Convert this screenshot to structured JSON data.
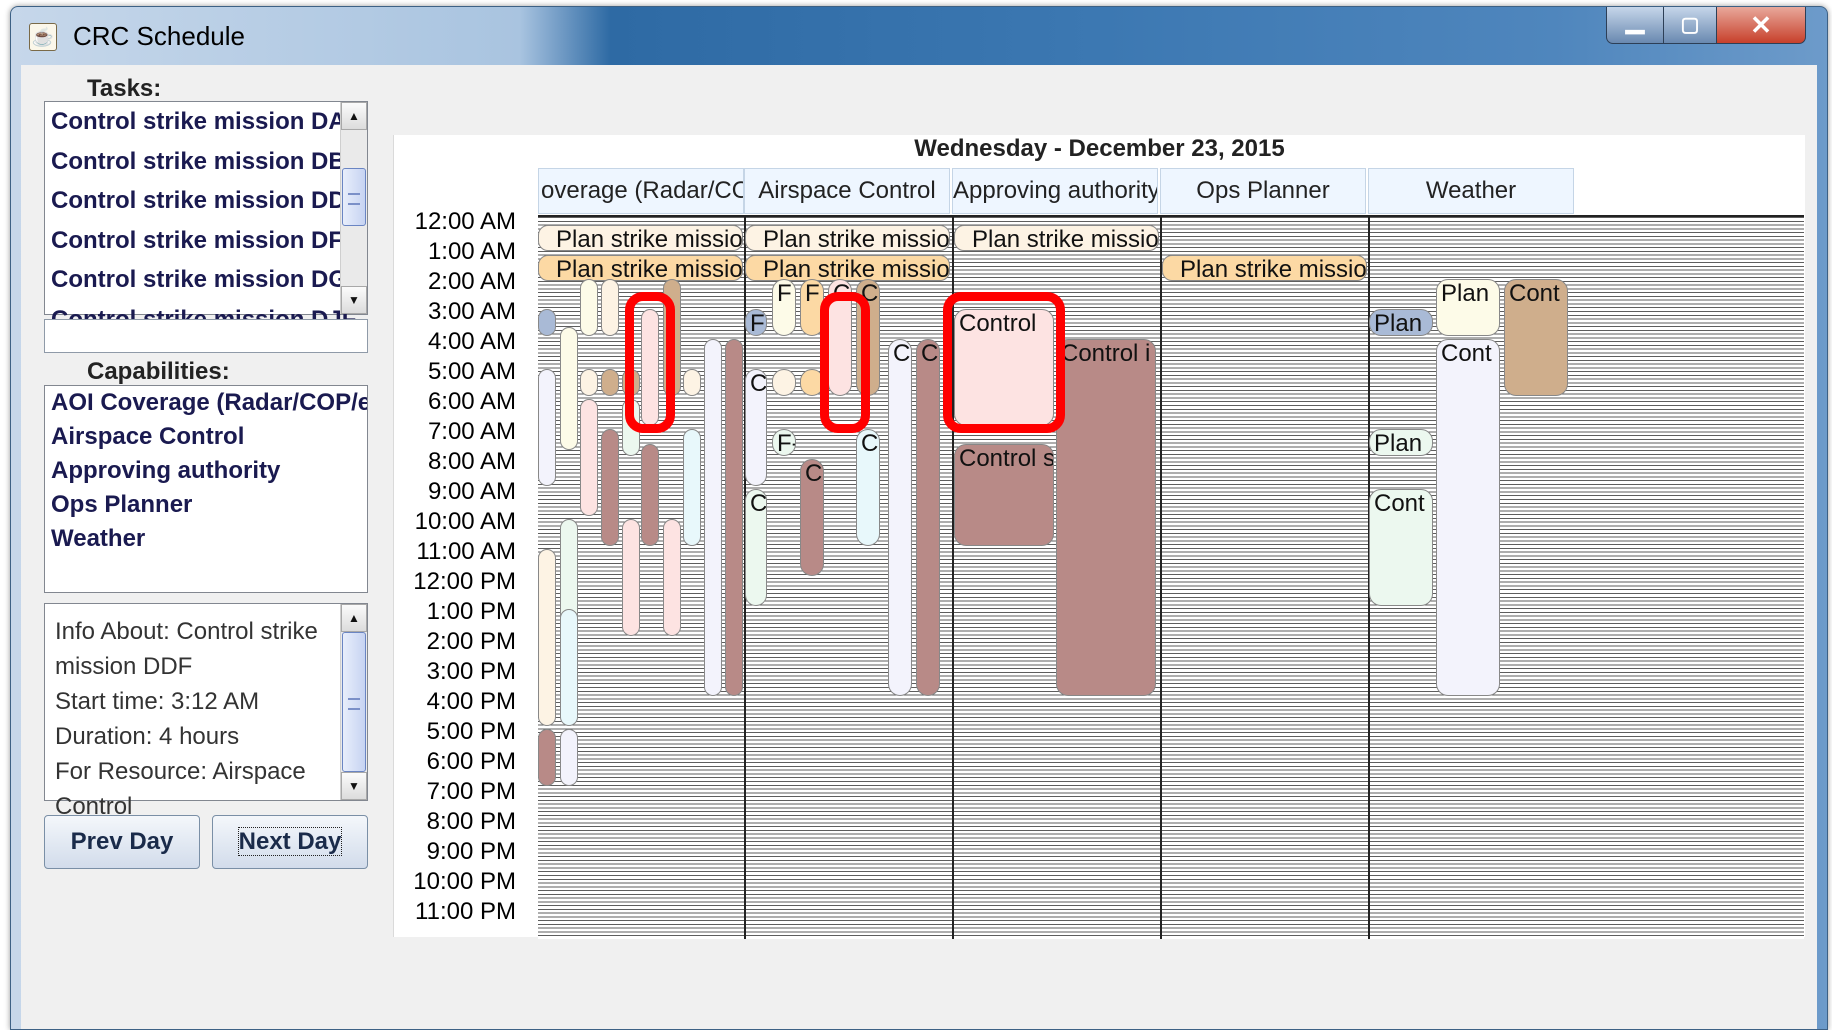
{
  "window": {
    "title": "CRC Schedule"
  },
  "tasks": {
    "label": "Tasks:",
    "items": [
      "Control strike mission DAN",
      "Control strike mission DBF",
      "Control strike mission DDF",
      "Control strike mission DFN",
      "Control strike mission DGN",
      "Control strike mission DJF"
    ],
    "search_value": ""
  },
  "capabilities": {
    "label": "Capabilities:",
    "items": [
      "AOI Coverage (Radar/COP/etc.",
      "Airspace Control",
      "Approving authority",
      "Ops Planner",
      "Weather"
    ]
  },
  "info": {
    "text": "Info About: Control strike\nmission DDF\nStart time: 3:12 AM\nDuration: 4 hours\nFor Resource: Airspace\nControl"
  },
  "buttons": {
    "prev_day": "Prev Day",
    "next_day": "Next Day"
  },
  "schedule": {
    "date": "Wednesday - December 23, 2015",
    "times": [
      "12:00 AM",
      "1:00 AM",
      "2:00 AM",
      "3:00 AM",
      "4:00 AM",
      "5:00 AM",
      "6:00 AM",
      "7:00 AM",
      "8:00 AM",
      "9:00 AM",
      "10:00 AM",
      "11:00 AM",
      "12:00 PM",
      "1:00 PM",
      "2:00 PM",
      "3:00 PM",
      "4:00 PM",
      "5:00 PM",
      "6:00 PM",
      "7:00 PM",
      "8:00 PM",
      "9:00 PM",
      "10:00 PM",
      "11:00 PM"
    ],
    "columns": [
      "overage (Radar/CO",
      "Airspace Control",
      "Approving authority",
      "Ops Planner",
      "Weather"
    ],
    "event_labels": {
      "plan_strike": "Plan strike missio",
      "plan": "Plan",
      "cont": "Cont",
      "control": "Control",
      "control_s": "Control s",
      "control_i": "Control i",
      "c": "C",
      "f": "F",
      "c_f": "C F",
      "f_dash": "F-"
    },
    "colors": {
      "highlight": "#ff0000",
      "cream": "#fdf3e4",
      "peach": "#fcd9a4",
      "tan": "#cfae8c",
      "mauve": "#b88a87",
      "pink": "#fde3e2",
      "lavender": "#f3f3fc",
      "mint": "#ecf8ef",
      "ice": "#e8f8fb",
      "blue": "#a9bad6",
      "ivory": "#fdfbe8"
    }
  }
}
